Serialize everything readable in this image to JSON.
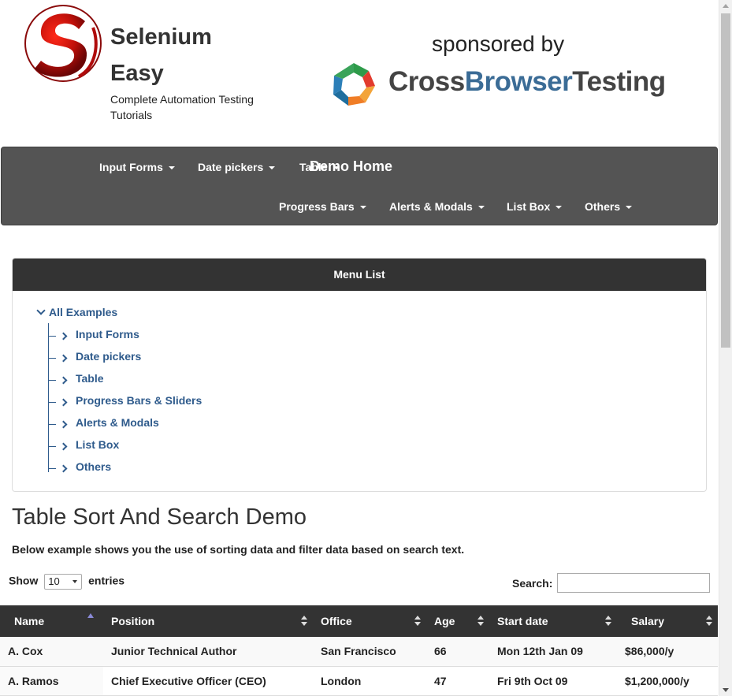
{
  "header": {
    "site_title": "Selenium Easy",
    "site_tagline": "Complete Automation Testing Tutorials",
    "sponsor_label": "sponsored by",
    "sponsor_name_part1": "Cross",
    "sponsor_name_part2": "Browser",
    "sponsor_name_part3": "Testing"
  },
  "navbar": {
    "brand": "Demo Home",
    "items": [
      {
        "label": "Input Forms"
      },
      {
        "label": "Date pickers"
      },
      {
        "label": "Table"
      },
      {
        "label": "Progress Bars"
      },
      {
        "label": "Alerts & Modals"
      },
      {
        "label": "List Box"
      },
      {
        "label": "Others"
      }
    ]
  },
  "menu_list": {
    "heading": "Menu List",
    "root": "All Examples",
    "items": [
      {
        "label": "Input Forms"
      },
      {
        "label": "Date pickers"
      },
      {
        "label": "Table"
      },
      {
        "label": "Progress Bars & Sliders"
      },
      {
        "label": "Alerts & Modals"
      },
      {
        "label": "List Box"
      },
      {
        "label": "Others"
      }
    ]
  },
  "main": {
    "title": "Table Sort And Search Demo",
    "description": "Below example shows you the use of sorting data and filter data based on search text.",
    "show_label": "Show",
    "entries_value": "10",
    "entries_label": "entries",
    "search_label": "Search:",
    "search_value": ""
  },
  "table": {
    "columns": [
      "Name",
      "Position",
      "Office",
      "Age",
      "Start date",
      "Salary"
    ],
    "rows": [
      [
        "A. Cox",
        "Junior Technical Author",
        "San Francisco",
        "66",
        "Mon 12th Jan 09",
        "$86,000/y"
      ],
      [
        "A. Ramos",
        "Chief Executive Officer (CEO)",
        "London",
        "47",
        "Fri 9th Oct 09",
        "$1,200,000/y"
      ]
    ]
  },
  "colors": {
    "navbar_bg": "#545454",
    "panel_heading_bg": "#333333",
    "link_blue": "#2f5b8c",
    "table_header_bg": "#333333"
  }
}
